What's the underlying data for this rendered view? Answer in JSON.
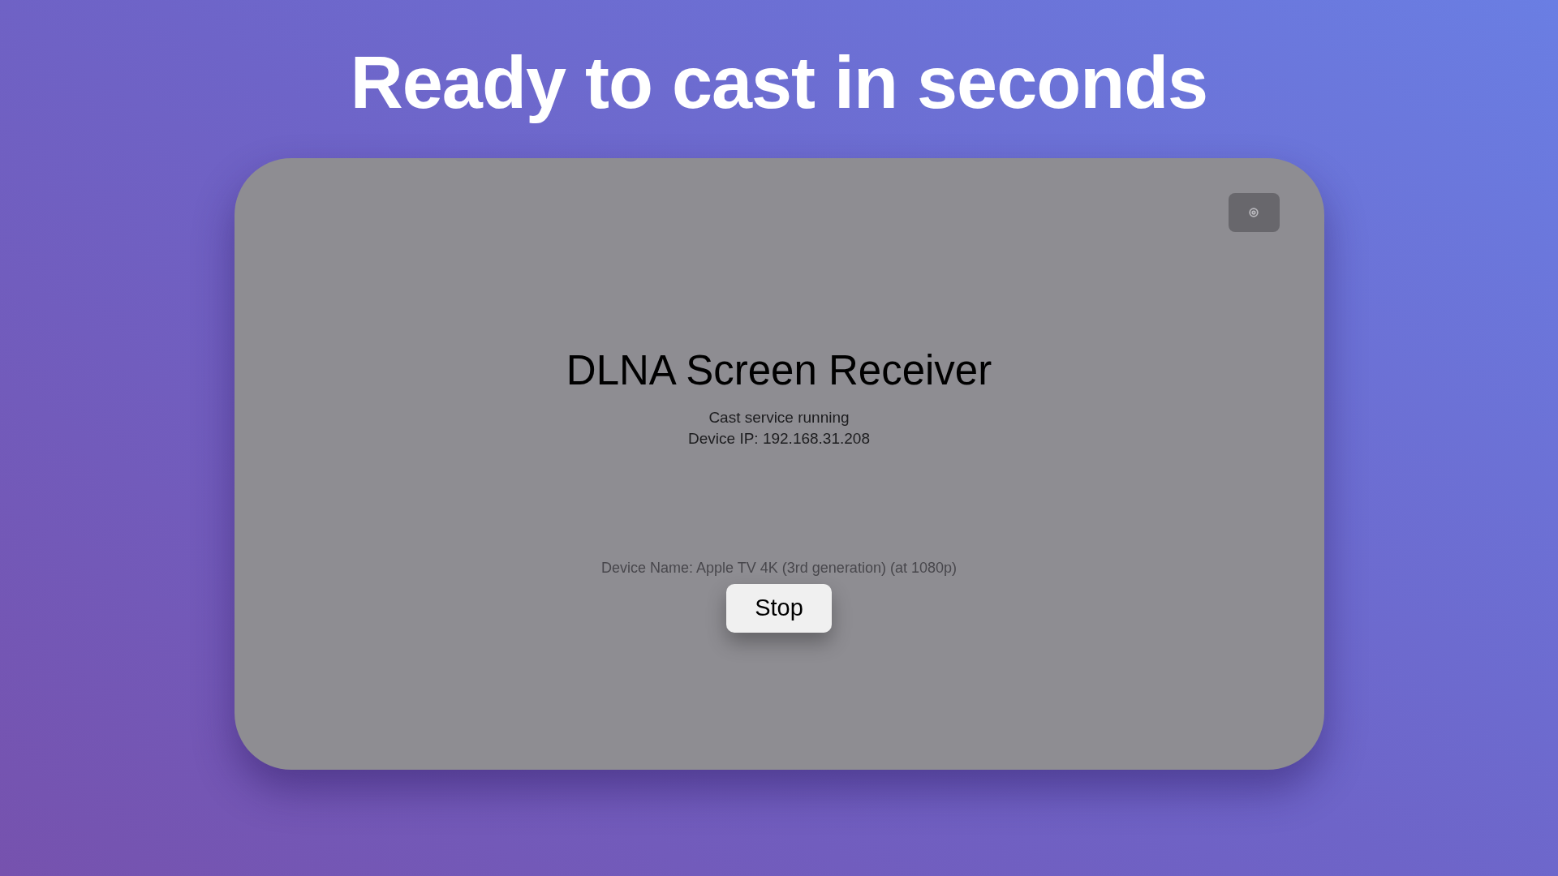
{
  "headline": "Ready to cast in seconds",
  "screen": {
    "title": "DLNA Screen Receiver",
    "status": "Cast service running",
    "device_ip": "Device IP: 192.168.31.208",
    "device_name": "Device Name: Apple TV 4K (3rd generation) (at 1080p)",
    "stop_button": "Stop"
  }
}
